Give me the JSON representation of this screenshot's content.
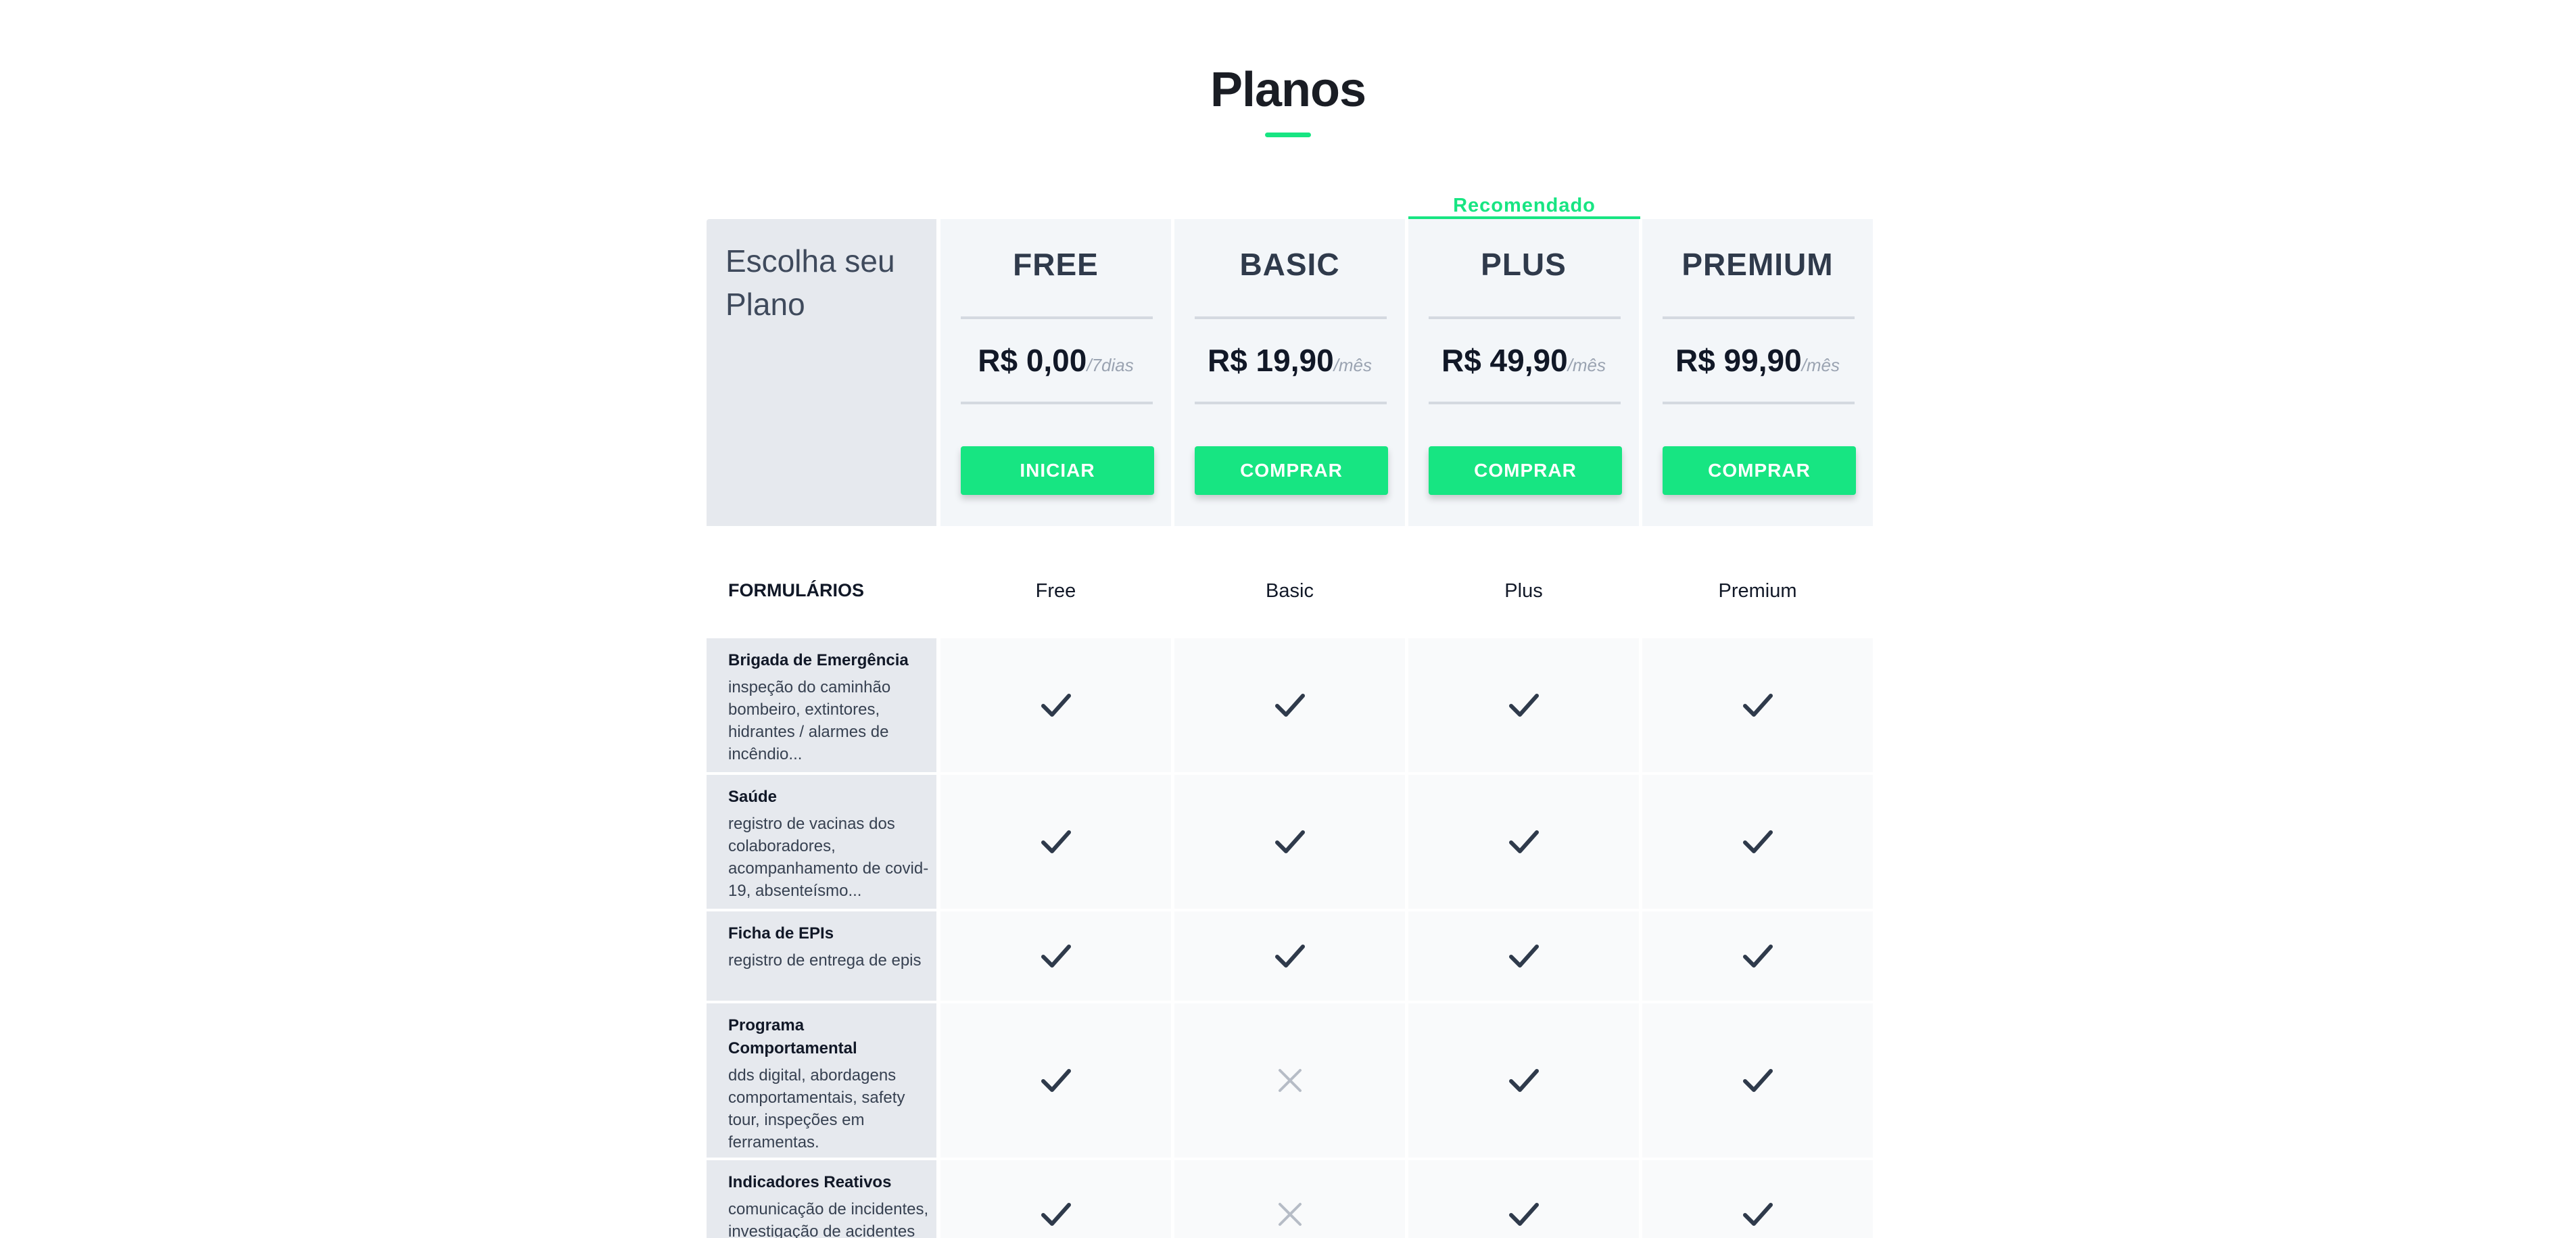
{
  "page": {
    "title": "Planos"
  },
  "pricing": {
    "choose_label": "Escolha seu Plano",
    "recommended_label": "Recomendado",
    "plans": [
      {
        "name": "FREE",
        "price": "R$ 0,00",
        "period": "/7dias",
        "button": "INICIAR",
        "column_label": "Free"
      },
      {
        "name": "BASIC",
        "price": "R$ 19,90",
        "period": "/mês",
        "button": "COMPRAR",
        "column_label": "Basic"
      },
      {
        "name": "PLUS",
        "price": "R$ 49,90",
        "period": "/mês",
        "button": "COMPRAR",
        "column_label": "Plus"
      },
      {
        "name": "PREMIUM",
        "price": "R$ 99,90",
        "period": "/mês",
        "button": "COMPRAR",
        "column_label": "Premium"
      }
    ]
  },
  "forms": {
    "section_label": "FORMULÁRIOS",
    "features": [
      {
        "title": "Brigada de Emergência",
        "description": "inspeção do caminhão bombeiro, extintores, hidrantes / alarmes de incêndio...",
        "availability": [
          true,
          true,
          true,
          true
        ]
      },
      {
        "title": "Saúde",
        "description": "registro de vacinas dos colaboradores, acompanhamento de covid-19, absenteísmo...",
        "availability": [
          true,
          true,
          true,
          true
        ]
      },
      {
        "title": "Ficha de EPIs",
        "description": "registro de entrega de epis",
        "availability": [
          true,
          true,
          true,
          true
        ]
      },
      {
        "title": "Programa Comportamental",
        "description": "dds digital, abordagens comportamentais, safety tour, inspeções em ferramentas.",
        "availability": [
          true,
          false,
          true,
          true
        ]
      },
      {
        "title": "Indicadores Reativos",
        "description": "comunicação de incidentes, investigação de acidentes",
        "availability": [
          true,
          false,
          true,
          true
        ]
      }
    ]
  },
  "icons": {
    "check": "check-icon",
    "cross": "cross-icon"
  },
  "colors": {
    "accent": "#17e582",
    "check": "#2f3a4b",
    "cross": "#b6bcc6",
    "label_bg": "#e6e9ee",
    "plan_bg": "#f3f6f9",
    "cell_bg": "#f9fafb"
  }
}
